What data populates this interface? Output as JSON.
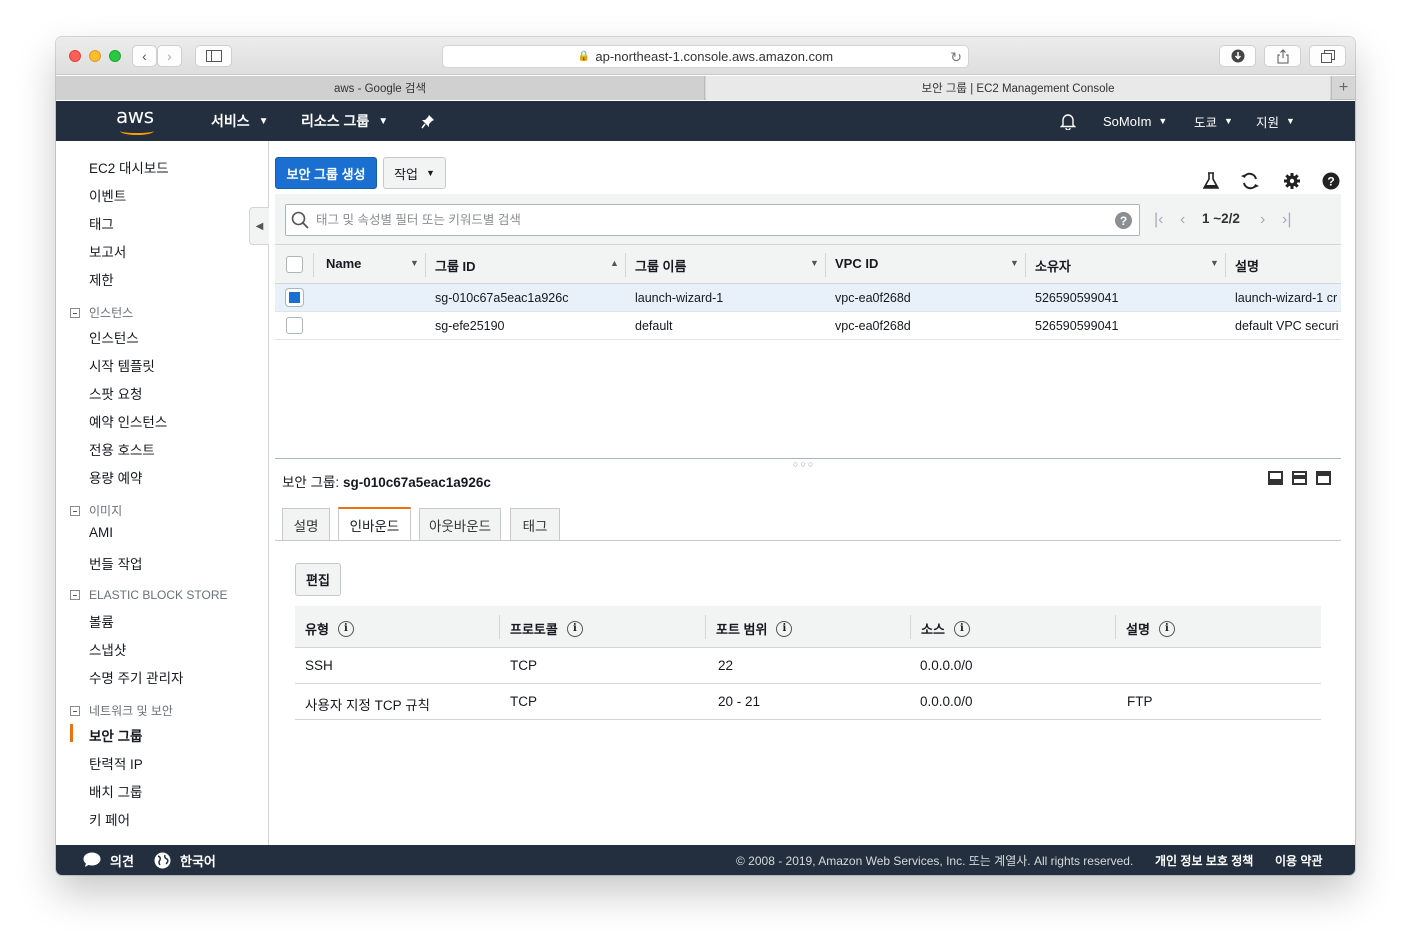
{
  "browser": {
    "url": "ap-northeast-1.console.aws.amazon.com",
    "tabs": [
      {
        "label": "aws - Google 검색",
        "active": false
      },
      {
        "label": "보안 그룹 | EC2 Management Console",
        "active": true
      }
    ]
  },
  "aws_nav": {
    "logo": "aws",
    "services": "서비스",
    "resource_groups": "리소스 그룹",
    "user": "SoMoIm",
    "region": "도쿄",
    "support": "지원"
  },
  "sidebar": {
    "top_items": [
      "EC2 대시보드",
      "이벤트",
      "태그",
      "보고서",
      "제한"
    ],
    "sections": [
      {
        "title": "인스턴스",
        "items": [
          "인스턴스",
          "시작 템플릿",
          "스팟 요청",
          "예약 인스턴스",
          "전용 호스트",
          "용량 예약"
        ]
      },
      {
        "title": "이미지",
        "items": [
          "AMI",
          "번들 작업"
        ]
      },
      {
        "title": "ELASTIC BLOCK STORE",
        "items": [
          "볼륨",
          "스냅샷",
          "수명 주기 관리자"
        ]
      },
      {
        "title": "네트워크 및 보안",
        "items": [
          "보안 그룹",
          "탄력적 IP",
          "배치 그룹",
          "키 페어"
        ]
      }
    ],
    "active_item": "보안 그룹"
  },
  "toolbar": {
    "create_button": "보안 그룹 생성",
    "actions_button": "작업",
    "search_placeholder": "태그 및 속성별 필터 또는 키워드별 검색",
    "pagination": "1 ~2/2"
  },
  "grid": {
    "columns": [
      "Name",
      "그룹 ID",
      "그룹 이름",
      "VPC ID",
      "소유자",
      "설명"
    ],
    "rows": [
      {
        "selected": true,
        "name": "",
        "group_id": "sg-010c67a5eac1a926c",
        "group_name": "launch-wizard-1",
        "vpc_id": "vpc-ea0f268d",
        "owner": "526590599041",
        "description": "launch-wizard-1 cr"
      },
      {
        "selected": false,
        "name": "",
        "group_id": "sg-efe25190",
        "group_name": "default",
        "vpc_id": "vpc-ea0f268d",
        "owner": "526590599041",
        "description": "default VPC securi"
      }
    ]
  },
  "detail": {
    "title_label": "보안 그룹:",
    "title_value": "sg-010c67a5eac1a926c",
    "tabs": [
      "설명",
      "인바운드",
      "아웃바운드",
      "태그"
    ],
    "active_tab": "인바운드",
    "edit_button": "편집",
    "rules_columns": [
      "유형",
      "프로토콜",
      "포트 범위",
      "소스",
      "설명"
    ],
    "rules": [
      {
        "type": "SSH",
        "protocol": "TCP",
        "port_range": "22",
        "source": "0.0.0.0/0",
        "description": ""
      },
      {
        "type": "사용자 지정 TCP 규칙",
        "protocol": "TCP",
        "port_range": "20 - 21",
        "source": "0.0.0.0/0",
        "description": "FTP"
      }
    ]
  },
  "footer": {
    "feedback": "의견",
    "language": "한국어",
    "copyright": "© 2008 - 2019, Amazon Web Services, Inc. 또는 계열사. All rights reserved.",
    "privacy": "개인 정보 보호 정책",
    "terms": "이용 약관"
  },
  "colors": {
    "nav_bg": "#232f3e",
    "primary_button": "#1a6fd1",
    "accent": "#ec7211"
  }
}
